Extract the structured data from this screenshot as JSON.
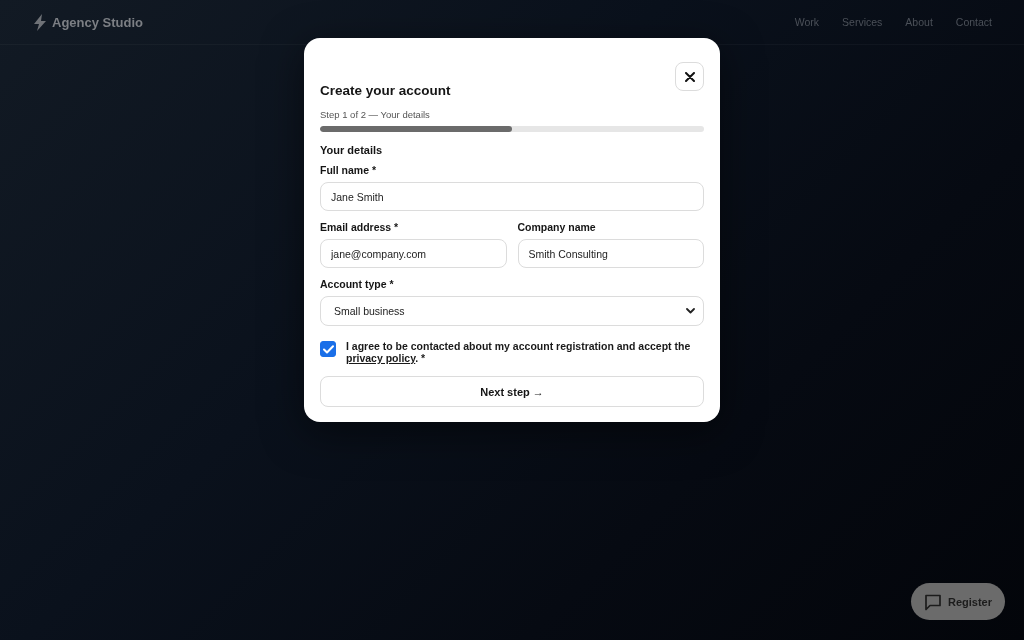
{
  "header": {
    "logo": "Agency Studio",
    "nav": [
      {
        "label": "Work"
      },
      {
        "label": "Services"
      },
      {
        "label": "About"
      },
      {
        "label": "Contact"
      }
    ]
  },
  "dialog": {
    "title": "Create your account",
    "step": "Step 1 of 2 — Your details",
    "progress": {
      "level": 0.5
    },
    "section_title": "Your details",
    "rows": [
      {
        "fields": [
          {
            "kind": "text",
            "label": "Full name *",
            "value": "Jane Smith"
          }
        ]
      },
      {
        "fields": [
          {
            "kind": "text",
            "label": "Email address *",
            "value": "jane@company.com"
          },
          {
            "kind": "text",
            "label": "Company name",
            "value": "Smith Consulting"
          }
        ]
      },
      {
        "fields": [
          {
            "kind": "select",
            "label": "Account type *",
            "value": "Small business"
          }
        ]
      }
    ],
    "consent": {
      "checked": true,
      "text": "I agree to be contacted about my account registration and accept the",
      "link": "privacy policy",
      "after_link": ". *"
    },
    "submit": "Next step →"
  },
  "register_button": "Register"
}
